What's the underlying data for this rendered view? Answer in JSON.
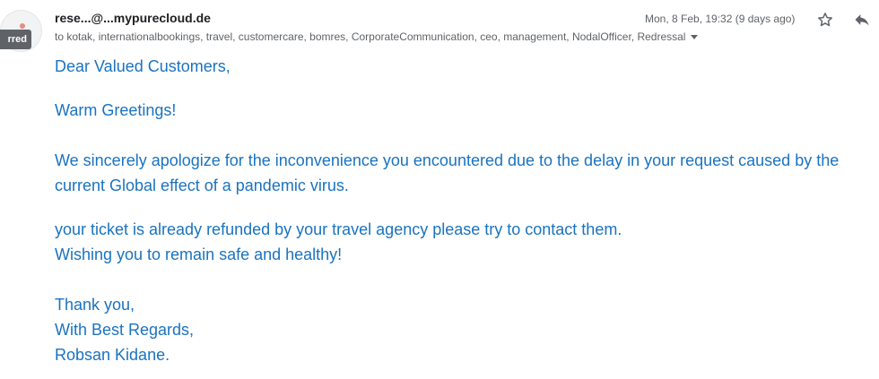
{
  "sender": {
    "name": "rese...@...mypurecloud.de",
    "tooltip": "rred"
  },
  "recipients": {
    "prefix": "to",
    "list": "kotak, internationalbookings, travel, customercare, bomres, CorporateCommunication, ceo, management, NodalOfficer, Redressal"
  },
  "date": "Mon, 8 Feb, 19:32 (9 days ago)",
  "icons": {
    "star": "star-icon",
    "reply": "reply-icon",
    "caret": "chevron-down-icon",
    "avatar": "avatar"
  },
  "colors": {
    "body_text": "#1a73c0",
    "meta_text": "#5f6368",
    "sender_text": "#202124",
    "tooltip_bg": "#5f6368"
  },
  "body": {
    "greeting": "Dear Valued Customers,",
    "warm": "Warm Greetings!",
    "apology": "We sincerely apologize for the inconvenience you encountered due to the delay in your request caused by the current Global effect of a pandemic virus.",
    "refund": "your ticket is already refunded by your travel agency please try to contact them.",
    "wish": "Wishing you to remain safe and healthy!",
    "thanks": "Thank you,",
    "regards": "With Best Regards,",
    "signature": "Robsan Kidane."
  }
}
